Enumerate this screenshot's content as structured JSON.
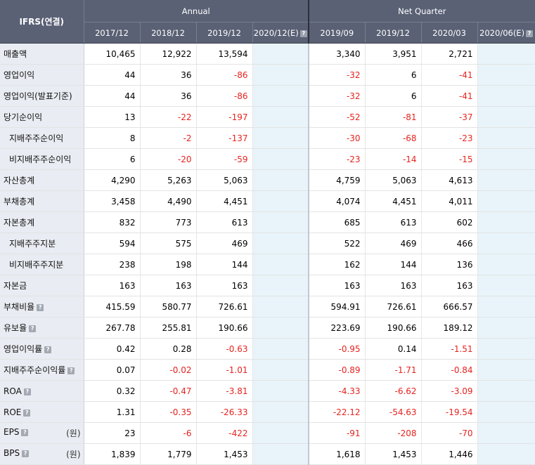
{
  "header": {
    "corner": "IFRS(연결)",
    "annual_label": "Annual",
    "quarter_label": "Net Quarter",
    "annual_periods": [
      "2017/12",
      "2018/12",
      "2019/12",
      "2020/12(E)"
    ],
    "quarter_periods": [
      "2019/09",
      "2019/12",
      "2020/03",
      "2020/06(E)"
    ]
  },
  "colors": {
    "header_bg": "#5a6175",
    "label_bg": "#e9ecf2",
    "estimate_bg": "#e8f4fa",
    "negative": "#e6231f"
  },
  "rows": [
    {
      "label": "매출액",
      "indent": false,
      "help": false,
      "unit": "",
      "annual": [
        "10,465",
        "12,922",
        "13,594",
        ""
      ],
      "quarter": [
        "3,340",
        "3,951",
        "2,721",
        ""
      ]
    },
    {
      "label": "영업이익",
      "indent": false,
      "help": false,
      "unit": "",
      "annual": [
        "44",
        "36",
        "-86",
        ""
      ],
      "quarter": [
        "-32",
        "6",
        "-41",
        ""
      ]
    },
    {
      "label": "영업이익(발표기준)",
      "indent": false,
      "help": false,
      "unit": "",
      "annual": [
        "44",
        "36",
        "-86",
        ""
      ],
      "quarter": [
        "-32",
        "6",
        "-41",
        ""
      ]
    },
    {
      "label": "당기순이익",
      "indent": false,
      "help": false,
      "unit": "",
      "annual": [
        "13",
        "-22",
        "-197",
        ""
      ],
      "quarter": [
        "-52",
        "-81",
        "-37",
        ""
      ]
    },
    {
      "label": "지배주주순이익",
      "indent": true,
      "help": false,
      "unit": "",
      "annual": [
        "8",
        "-2",
        "-137",
        ""
      ],
      "quarter": [
        "-30",
        "-68",
        "-23",
        ""
      ]
    },
    {
      "label": "비지배주주순이익",
      "indent": true,
      "help": false,
      "unit": "",
      "annual": [
        "6",
        "-20",
        "-59",
        ""
      ],
      "quarter": [
        "-23",
        "-14",
        "-15",
        ""
      ]
    },
    {
      "label": "자산총계",
      "indent": false,
      "help": false,
      "unit": "",
      "annual": [
        "4,290",
        "5,263",
        "5,063",
        ""
      ],
      "quarter": [
        "4,759",
        "5,063",
        "4,613",
        ""
      ]
    },
    {
      "label": "부채총계",
      "indent": false,
      "help": false,
      "unit": "",
      "annual": [
        "3,458",
        "4,490",
        "4,451",
        ""
      ],
      "quarter": [
        "4,074",
        "4,451",
        "4,011",
        ""
      ]
    },
    {
      "label": "자본총계",
      "indent": false,
      "help": false,
      "unit": "",
      "annual": [
        "832",
        "773",
        "613",
        ""
      ],
      "quarter": [
        "685",
        "613",
        "602",
        ""
      ]
    },
    {
      "label": "지배주주지분",
      "indent": true,
      "help": false,
      "unit": "",
      "annual": [
        "594",
        "575",
        "469",
        ""
      ],
      "quarter": [
        "522",
        "469",
        "466",
        ""
      ]
    },
    {
      "label": "비지배주주지분",
      "indent": true,
      "help": false,
      "unit": "",
      "annual": [
        "238",
        "198",
        "144",
        ""
      ],
      "quarter": [
        "162",
        "144",
        "136",
        ""
      ]
    },
    {
      "label": "자본금",
      "indent": false,
      "help": false,
      "unit": "",
      "annual": [
        "163",
        "163",
        "163",
        ""
      ],
      "quarter": [
        "163",
        "163",
        "163",
        ""
      ]
    },
    {
      "label": "부채비율",
      "indent": false,
      "help": true,
      "unit": "",
      "annual": [
        "415.59",
        "580.77",
        "726.61",
        ""
      ],
      "quarter": [
        "594.91",
        "726.61",
        "666.57",
        ""
      ]
    },
    {
      "label": "유보율",
      "indent": false,
      "help": true,
      "unit": "",
      "annual": [
        "267.78",
        "255.81",
        "190.66",
        ""
      ],
      "quarter": [
        "223.69",
        "190.66",
        "189.12",
        ""
      ]
    },
    {
      "label": "영업이익률",
      "indent": false,
      "help": true,
      "unit": "",
      "annual": [
        "0.42",
        "0.28",
        "-0.63",
        ""
      ],
      "quarter": [
        "-0.95",
        "0.14",
        "-1.51",
        ""
      ]
    },
    {
      "label": "지배주주순이익률",
      "indent": false,
      "help": true,
      "unit": "",
      "annual": [
        "0.07",
        "-0.02",
        "-1.01",
        ""
      ],
      "quarter": [
        "-0.89",
        "-1.71",
        "-0.84",
        ""
      ]
    },
    {
      "label": "ROA",
      "indent": false,
      "help": true,
      "unit": "",
      "annual": [
        "0.32",
        "-0.47",
        "-3.81",
        ""
      ],
      "quarter": [
        "-4.33",
        "-6.62",
        "-3.09",
        ""
      ]
    },
    {
      "label": "ROE",
      "indent": false,
      "help": true,
      "unit": "",
      "annual": [
        "1.31",
        "-0.35",
        "-26.33",
        ""
      ],
      "quarter": [
        "-22.12",
        "-54.63",
        "-19.54",
        ""
      ]
    },
    {
      "label": "EPS",
      "indent": false,
      "help": true,
      "unit": "(원)",
      "annual": [
        "23",
        "-6",
        "-422",
        ""
      ],
      "quarter": [
        "-91",
        "-208",
        "-70",
        ""
      ]
    },
    {
      "label": "BPS",
      "indent": false,
      "help": true,
      "unit": "(원)",
      "annual": [
        "1,839",
        "1,779",
        "1,453",
        ""
      ],
      "quarter": [
        "1,618",
        "1,453",
        "1,446",
        ""
      ]
    }
  ]
}
